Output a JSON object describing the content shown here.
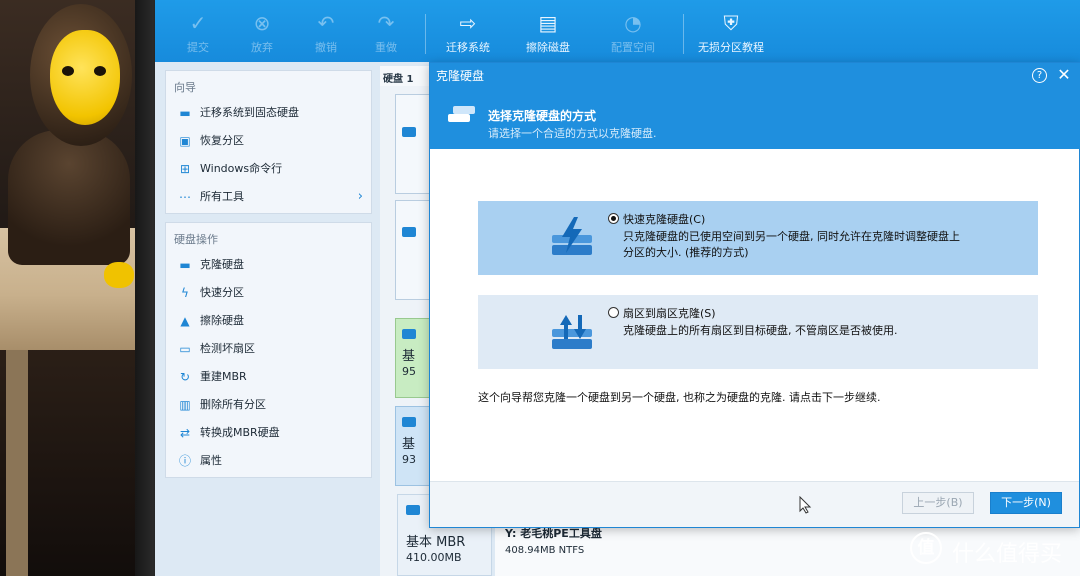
{
  "toolbar": {
    "items": [
      {
        "label": "提交",
        "icon": "check-icon",
        "disabled": true
      },
      {
        "label": "放弃",
        "icon": "cancel-icon",
        "disabled": true
      },
      {
        "label": "撤销",
        "icon": "undo-icon",
        "disabled": true
      },
      {
        "label": "重做",
        "icon": "redo-icon",
        "disabled": true
      },
      {
        "label": "迁移系统",
        "icon": "migrate-icon",
        "disabled": false
      },
      {
        "label": "擦除磁盘",
        "icon": "wipe-disk-icon",
        "disabled": false
      },
      {
        "label": "配置空间",
        "icon": "allocate-space-icon",
        "disabled": true
      },
      {
        "label": "无损分区教程",
        "icon": "shield-plus-icon",
        "disabled": false
      }
    ]
  },
  "sidebar": {
    "wizard_heading": "向导",
    "wizard_items": [
      {
        "label": "迁移系统到固态硬盘",
        "icon": "disk-icon"
      },
      {
        "label": "恢复分区",
        "icon": "restore-icon"
      },
      {
        "label": "Windows命令行",
        "icon": "windows-icon"
      },
      {
        "label": "所有工具",
        "icon": "more-icon",
        "chevron": "›"
      }
    ],
    "disk_heading": "硬盘操作",
    "disk_items": [
      {
        "label": "克隆硬盘",
        "icon": "clone-disk-icon"
      },
      {
        "label": "快速分区",
        "icon": "lightning-icon"
      },
      {
        "label": "擦除硬盘",
        "icon": "broom-icon"
      },
      {
        "label": "检测坏扇区",
        "icon": "scan-icon"
      },
      {
        "label": "重建MBR",
        "icon": "rebuild-icon"
      },
      {
        "label": "删除所有分区",
        "icon": "trash-icon"
      },
      {
        "label": "转换成MBR硬盘",
        "icon": "convert-icon"
      },
      {
        "label": "属性",
        "icon": "info-icon"
      }
    ]
  },
  "disk_panel": {
    "tab_label": "硬盘 1",
    "cards": [
      {
        "line1": "基",
        "line2": "95"
      },
      {
        "line1": "基",
        "line2": "93"
      }
    ],
    "bottom_disk": {
      "type": "基本 MBR",
      "size": "410.00MB"
    },
    "bottom_partition": {
      "name": "Y: 老毛桃PE工具盘",
      "info": "408.94MB NTFS"
    }
  },
  "dialog": {
    "title": "克隆硬盘",
    "help": "?",
    "close": "✕",
    "header_title": "选择克隆硬盘的方式",
    "header_subtitle": "请选择一个合适的方式以克隆硬盘.",
    "options": [
      {
        "label": "快速克隆硬盘(C)",
        "description": "只克隆硬盘的已使用空间到另一个硬盘, 同时允许在克隆时调整硬盘上分区的大小. (推荐的方式)",
        "selected": true
      },
      {
        "label": "扇区到扇区克隆(S)",
        "description": "克隆硬盘上的所有扇区到目标硬盘, 不管扇区是否被使用.",
        "selected": false
      }
    ],
    "hint": "这个向导帮您克隆一个硬盘到另一个硬盘, 也称之为硬盘的克隆. 请点击下一步继续.",
    "prev_button": "上一步(B)",
    "next_button": "下一步(N)"
  },
  "watermark": {
    "logo": "值",
    "text": "什么值得买"
  },
  "colors": {
    "accent": "#1f8fde",
    "selected_option": "#a9d0f1",
    "option": "#dfeaf5",
    "green_card": "#c8ecc2"
  }
}
